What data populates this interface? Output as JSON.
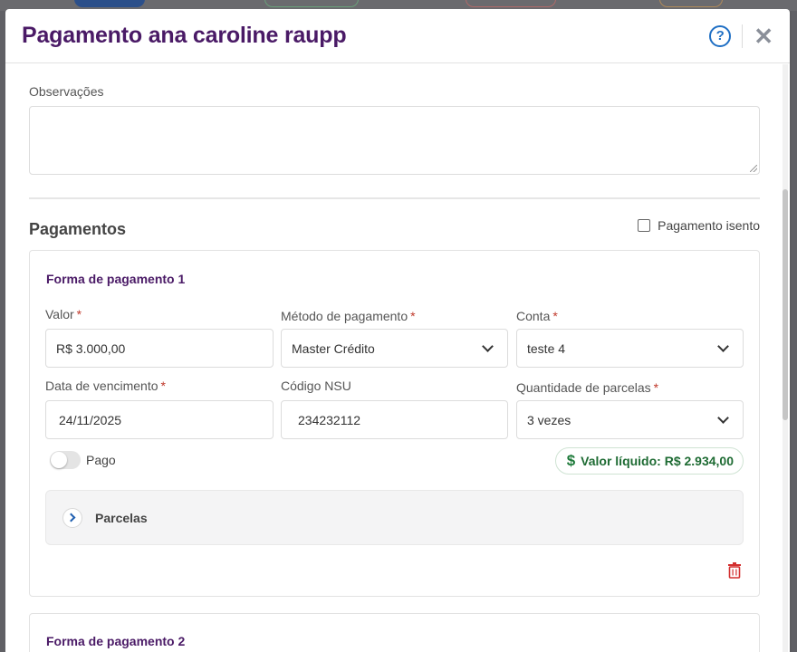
{
  "modal": {
    "title": "Pagamento ana caroline raupp"
  },
  "observacoes": {
    "label": "Observações",
    "value": ""
  },
  "pagamentos": {
    "title": "Pagamentos",
    "isento_label": "Pagamento isento",
    "isento_checked": false
  },
  "forma1": {
    "title": "Forma de pagamento 1",
    "valor_label": "Valor",
    "valor_value": "R$ 3.000,00",
    "metodo_label": "Método de pagamento",
    "metodo_value": "Master Crédito",
    "conta_label": "Conta",
    "conta_value": "teste 4",
    "vencimento_label": "Data de vencimento",
    "vencimento_value": "24/11/2025",
    "nsu_label": "Código NSU",
    "nsu_value": "234232112",
    "parcelas_label": "Quantidade de parcelas",
    "parcelas_value": "3 vezes",
    "pago_label": "Pago",
    "pago_on": false,
    "liquido_text": "Valor líquido: R$ 2.934,00",
    "parcelas_section_label": "Parcelas"
  },
  "forma2": {
    "title": "Forma de pagamento 2"
  },
  "icons": {
    "help": "help-circle-icon",
    "close": "close-icon",
    "dollar": "dollar-icon",
    "chevron_down": "chevron-down-icon",
    "chevron_right": "chevron-right-icon",
    "trash": "trash-icon"
  },
  "colors": {
    "title": "#4a1a66",
    "accent_blue": "#1f6fc4",
    "required": "#c0392b",
    "success": "#1e6b33",
    "danger": "#d32f2f"
  }
}
